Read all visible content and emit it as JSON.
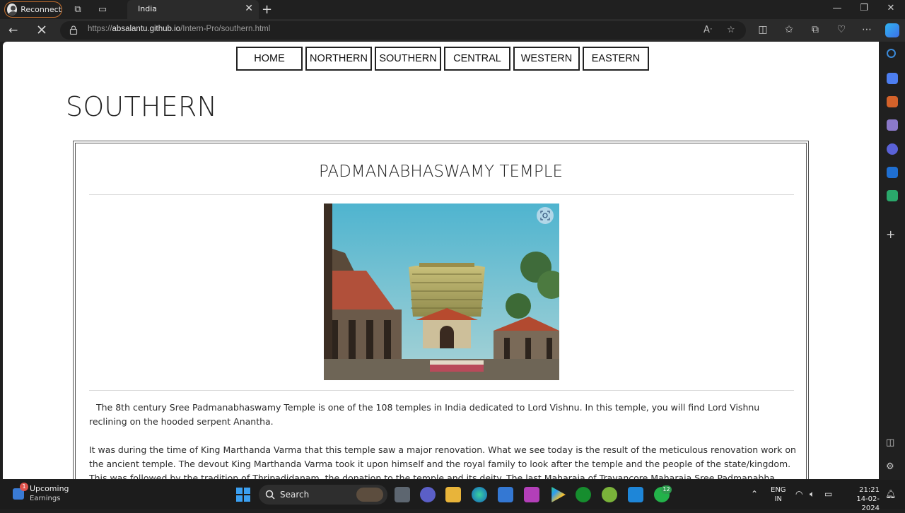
{
  "browser": {
    "profile_button": "Reconnect",
    "tab_title": "India",
    "url": {
      "prefix": "https://",
      "domain": "absalantu.github.io",
      "path": "/Intern-Pro/southern.html"
    }
  },
  "site": {
    "nav": [
      "HOME",
      "NORTHERN",
      "SOUTHERN",
      "CENTRAL",
      "WESTERN",
      "EASTERN"
    ],
    "page_title": "SOUTHERN",
    "card": {
      "heading": "PADMANABHASWAMY TEMPLE",
      "paragraphs": [
        "The 8th century Sree Padmanabhaswamy Temple is one of the 108 temples in India dedicated to Lord Vishnu. In this temple, you will find Lord Vishnu reclining on the hooded serpent Anantha.",
        "It was during the time of King Marthanda Varma that this temple saw a major renovation. What we see today is the result of the meticulous renovation work on the ancient temple. The devout King Marthanda Varma took it upon himself and the royal family to look after the temple and the people of the state/kingdom. This was followed by the tradition of Thripadidanam, the donation to the temple and its deity. The last Maharaja of Travancore Maharaja Sree Padmanabha Dasa Sree Chithira"
      ]
    }
  },
  "taskbar": {
    "widget_title": "Upcoming",
    "widget_sub": "Earnings",
    "widget_badge": "1",
    "search_label": "Search",
    "whatsapp_badge": "12",
    "lang_top": "ENG",
    "lang_bottom": "IN",
    "time": "21:21",
    "date": "14-02-2024"
  }
}
